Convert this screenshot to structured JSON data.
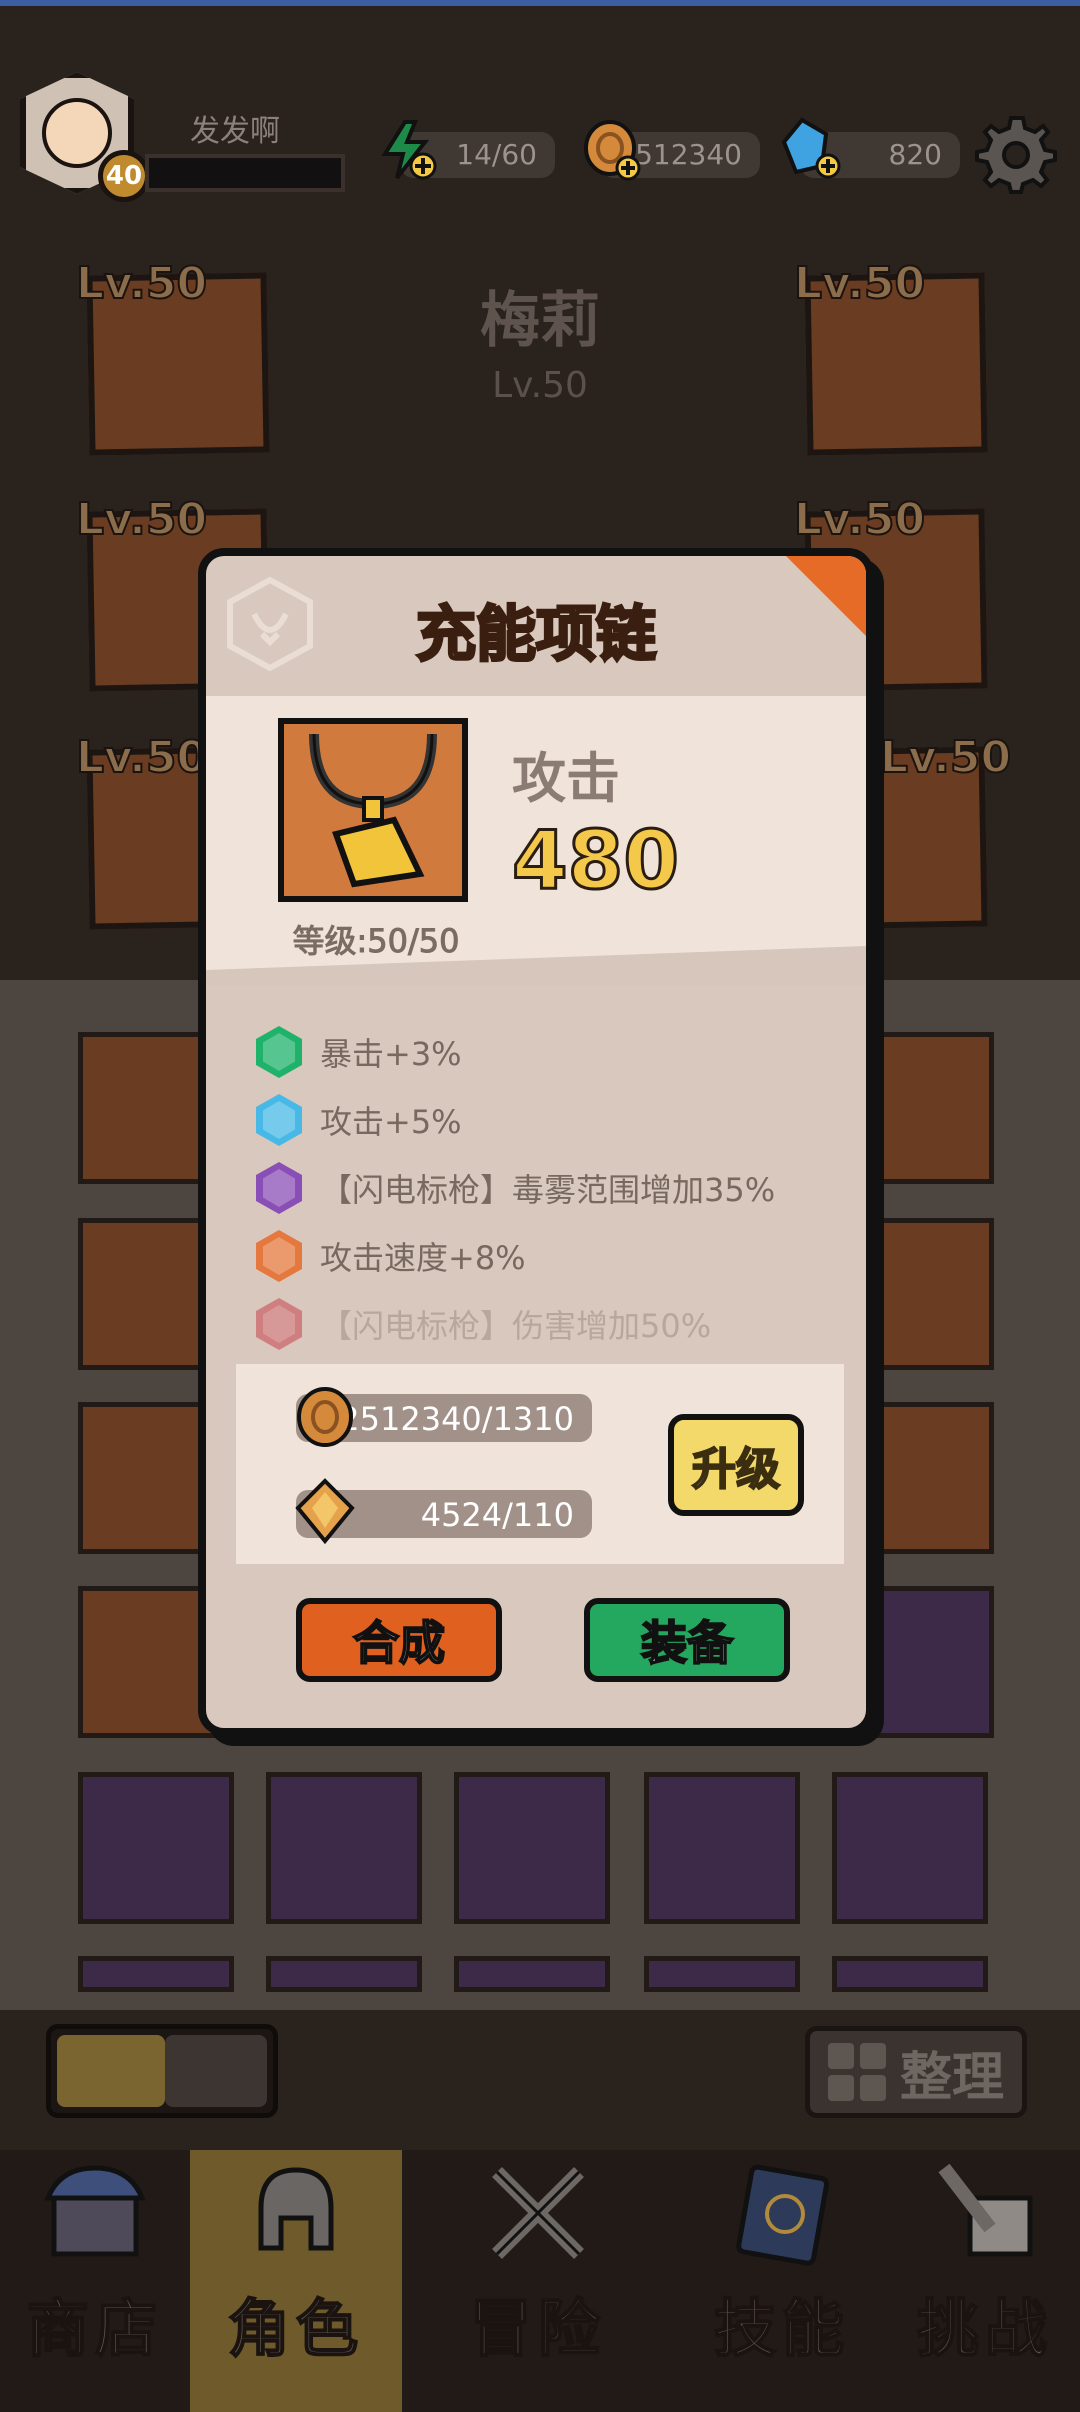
{
  "player": {
    "name": "发发啊",
    "level": "40"
  },
  "resources": {
    "energy": "14/60",
    "coins": "2512340",
    "gems": "820"
  },
  "character": {
    "name": "梅莉",
    "level": "Lv.50",
    "slot_levels": [
      "Lv.50",
      "Lv.50",
      "Lv.50",
      "Lv.50",
      "Lv.50",
      "Lv.50"
    ]
  },
  "modal": {
    "title": "充能项链",
    "item_level": "等级:50/50",
    "stat_label": "攻击",
    "stat_value": "480",
    "attributes": [
      {
        "text": "暴击+3%",
        "color": "#1fb26a"
      },
      {
        "text": "攻击+5%",
        "color": "#48b9e6"
      },
      {
        "text": "【闪电标枪】毒雾范围增加35%",
        "color": "#8a4fb6"
      },
      {
        "text": "攻击速度+8%",
        "color": "#e5783e"
      },
      {
        "text": "【闪电标枪】伤害增加50%",
        "color": "#c9444f"
      }
    ],
    "cost_coins": "2512340/1310",
    "cost_stones": "4524/110",
    "upgrade_label": "升级",
    "merge_label": "合成",
    "equip_label": "装备"
  },
  "toolbar": {
    "arrange_label": "整理"
  },
  "nav": [
    {
      "label": "商店"
    },
    {
      "label": "角色"
    },
    {
      "label": "冒险"
    },
    {
      "label": "技能"
    },
    {
      "label": "挑战"
    }
  ],
  "colors": {
    "accent": "#e8813a",
    "active_tab": "#f0b93b",
    "upgrade": "#f3d96a",
    "merge": "#e06020",
    "equip": "#24a75e"
  }
}
